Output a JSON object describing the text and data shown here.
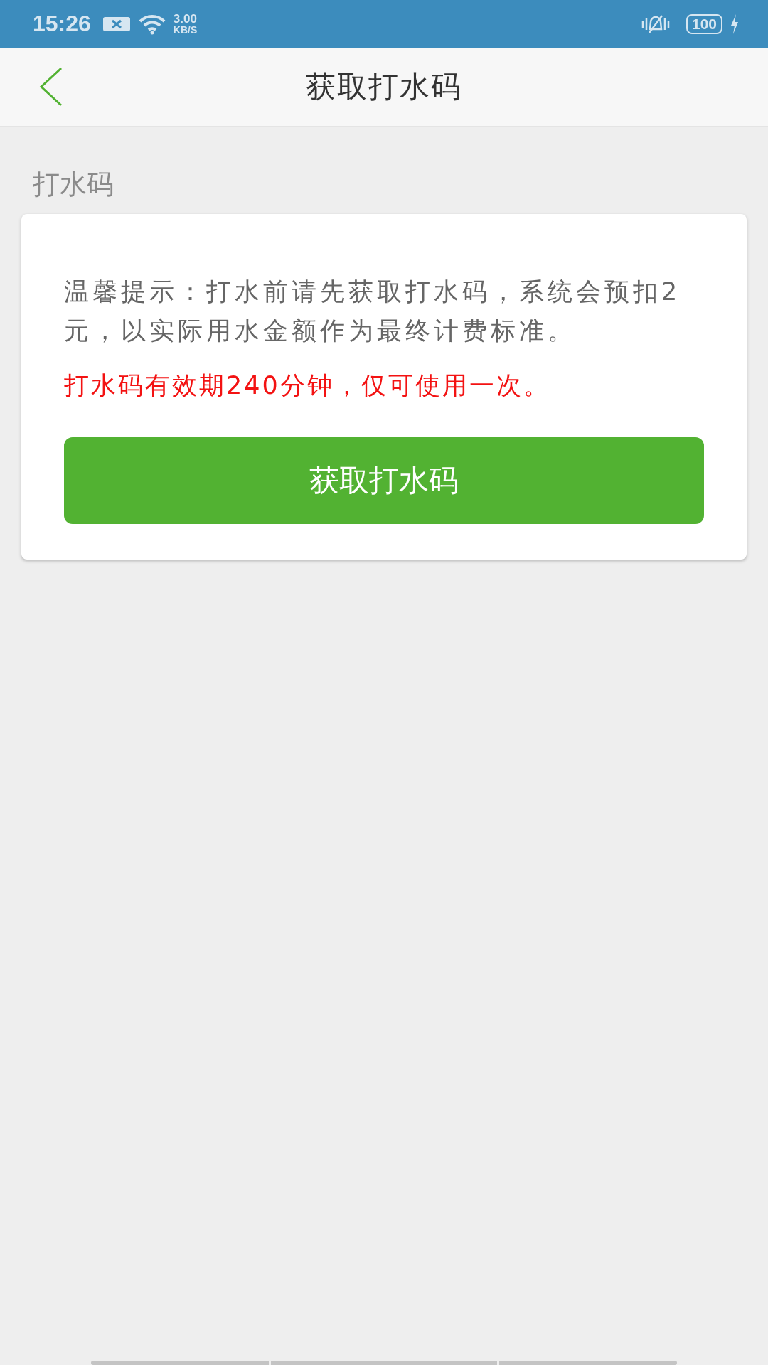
{
  "status_bar": {
    "time": "15:26",
    "speed_value": "3.00",
    "speed_unit": "KB/S",
    "battery": "100"
  },
  "header": {
    "title": "获取打水码"
  },
  "section_label": "打水码",
  "card": {
    "tip": "温馨提示：打水前请先获取打水码，系统会预扣2元，以实际用水金额作为最终计费标准。",
    "warning": "打水码有效期240分钟，仅可使用一次。",
    "button": "获取打水码"
  }
}
